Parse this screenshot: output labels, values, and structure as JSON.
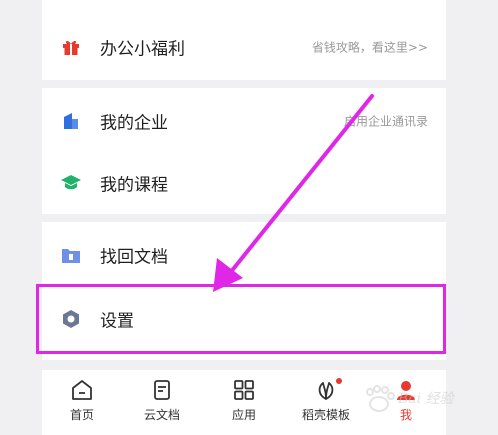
{
  "menu": {
    "welfare": {
      "label": "办公小福利",
      "hint": "省钱攻略，看这里>>",
      "icon": "gift-icon"
    },
    "enterprise": {
      "label": "我的企业",
      "hint": "启用企业通讯录",
      "icon": "enterprise-icon"
    },
    "courses": {
      "label": "我的课程",
      "icon": "course-icon"
    },
    "recover": {
      "label": "找回文档",
      "icon": "folder-recover-icon"
    },
    "settings": {
      "label": "设置",
      "icon": "hexagon-settings-icon"
    }
  },
  "tabbar": {
    "items": [
      {
        "label": "首页",
        "icon": "home-icon"
      },
      {
        "label": "云文档",
        "icon": "document-icon"
      },
      {
        "label": "应用",
        "icon": "apps-grid-icon"
      },
      {
        "label": "稻壳模板",
        "icon": "leaf-template-icon",
        "badge_dot": true
      },
      {
        "label": "我",
        "icon": "person-icon",
        "active": true
      }
    ]
  },
  "colors": {
    "accent_red": "#e8392f",
    "highlight_magenta": "#e026e6",
    "enterprise_blue": "#2f6fe0",
    "course_green": "#1fb26a"
  }
}
